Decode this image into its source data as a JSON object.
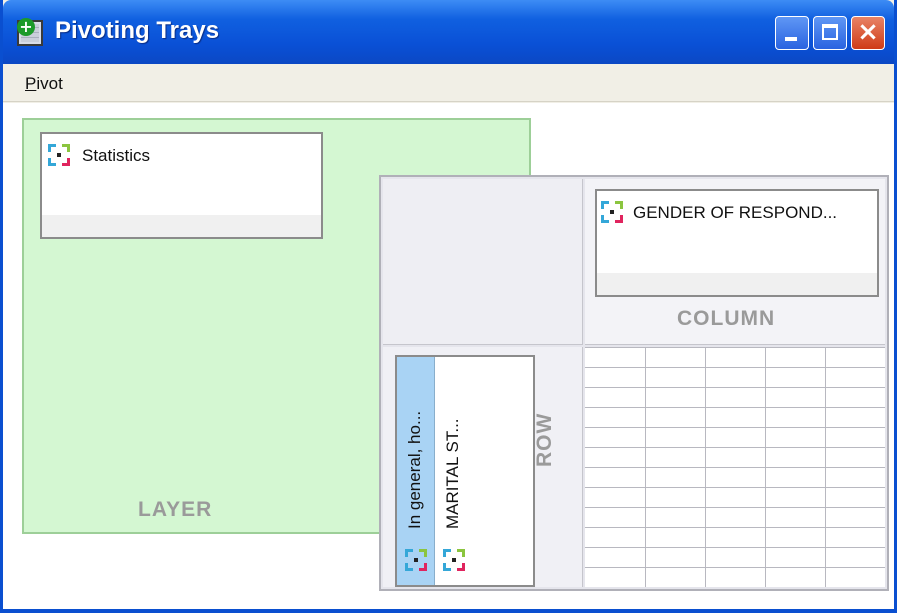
{
  "window": {
    "title": "Pivoting Trays",
    "controls": {
      "minimize_icon": "minimize-icon",
      "maximize_icon": "maximize-icon",
      "close_icon": "close-icon"
    }
  },
  "menu": {
    "items": [
      {
        "mnemonic": "P",
        "rest": "ivot"
      }
    ]
  },
  "layer": {
    "label": "LAYER",
    "items": [
      {
        "label": "Statistics",
        "icon": "pivot-icon"
      }
    ]
  },
  "column": {
    "label": "COLUMN",
    "items": [
      {
        "label": "GENDER OF RESPOND...",
        "icon": "pivot-icon"
      }
    ]
  },
  "row": {
    "label": "ROW",
    "items": [
      {
        "label": "In general, ho...",
        "icon": "pivot-icon",
        "selected": true
      },
      {
        "label": "MARITAL ST...",
        "icon": "pivot-icon",
        "selected": false
      }
    ]
  },
  "colors": {
    "titlebar": "#0a50d6",
    "layer_tray": "#d4f7d2",
    "row_selected": "#a9d3f4",
    "tray_label": "#9a9a9a"
  }
}
